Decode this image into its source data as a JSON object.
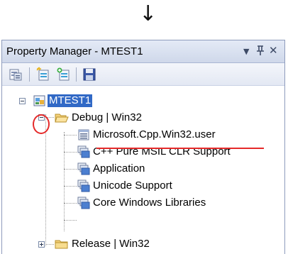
{
  "annotation": {
    "arrow": "↓"
  },
  "panel": {
    "title": "Property Manager - MTEST1",
    "controls": {
      "dropdown": "▼",
      "pin": "ᵖ",
      "close": "✕"
    }
  },
  "toolbar": {
    "buttons": [
      "properties-icon",
      "add-new-property-sheet-icon",
      "add-existing-property-sheet-icon",
      "save-icon"
    ]
  },
  "tree": {
    "root": {
      "label": "MTEST1",
      "expanded": true
    },
    "debug": {
      "label": "Debug | Win32",
      "expanded": true
    },
    "debug_items": [
      "Microsoft.Cpp.Win32.user",
      "C++ Pure MSIL CLR Support",
      "Application",
      "Unicode Support",
      "Core Windows Libraries"
    ],
    "release": {
      "label": "Release | Win32",
      "expanded": false
    }
  },
  "colors": {
    "highlight": "#e52a2a",
    "selection": "#3169c6"
  }
}
